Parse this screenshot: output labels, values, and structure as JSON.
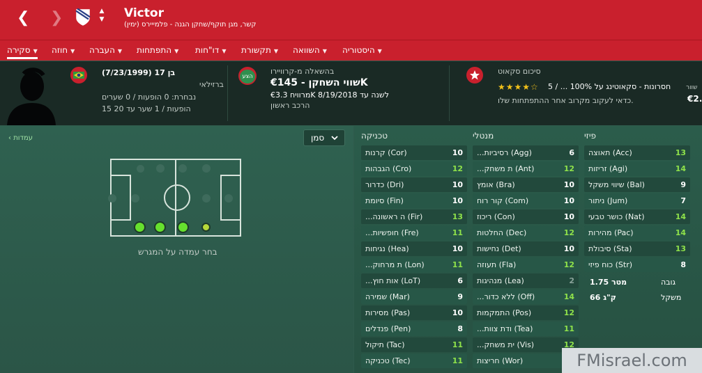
{
  "header": {
    "player_name": "Victor",
    "subtitle": "(ימין) קשר, מגן תוקף/שחקן הגנה - פלמייירס"
  },
  "tabs": [
    {
      "label": "סקירה",
      "active": true
    },
    {
      "label": "חוזה"
    },
    {
      "label": "העברה"
    },
    {
      "label": "התפתחות"
    },
    {
      "label": "דו\"חות"
    },
    {
      "label": "תקשורת"
    },
    {
      "label": "השוואה"
    },
    {
      "label": "היסטוריה"
    }
  ],
  "info": {
    "profile": {
      "age_text": "(7/23/1999) בן 17",
      "nationality": "ברזילאי",
      "caps": "נבחרת: 0 הופעות / 0 שערים",
      "club_stats": "15 הופעות / 1 שער עד 20"
    },
    "loan": {
      "badge": "הצע",
      "loan_text": "בהשאלה מ-קרוויירו",
      "value_label": "שווי השחקן - €145K",
      "wage_text": "מרוויח €3.3K לשנה עד 8/19/2018",
      "role": "הרכב ראשון"
    },
    "scout": {
      "heading": "סיכום סקאוט",
      "stars": 4,
      "summary": "5 / ... חסרונות - סקאוטינג על 100%",
      "note": "כדאי לעקוב מקרוב אחר ההתפתחות שלו.",
      "edge_label": "שוור",
      "edge_value": "€2."
    }
  },
  "left_panel": {
    "positions_link": "עמדות",
    "dropdown_value": "סמן",
    "pitch_hint": "בחר עמדה על המגרש"
  },
  "attributes": {
    "technical": {
      "heading": "טכניקה",
      "rows": [
        {
          "label": "קרנות (Cor)",
          "value": "10"
        },
        {
          "label": "הגבהות (Cro)",
          "value": "12"
        },
        {
          "label": "כדרור (Dri)",
          "value": "10"
        },
        {
          "label": "סיומת (Fin)",
          "value": "10"
        },
        {
          "label": "...ה ראשונה (Fir)",
          "value": "13"
        },
        {
          "label": "...חופשיות (Fre)",
          "value": "11"
        },
        {
          "label": "נגיחות (Hea)",
          "value": "10"
        },
        {
          "label": "...ת מרחוק (Lon)",
          "value": "11"
        },
        {
          "label": "...אות חוץ (LoT)",
          "value": "6"
        },
        {
          "label": "שמירה (Mar)",
          "value": "9"
        },
        {
          "label": "מסירות (Pas)",
          "value": "10"
        },
        {
          "label": "פנדלים (Pen)",
          "value": "8"
        },
        {
          "label": "תיקול (Tac)",
          "value": "11"
        },
        {
          "label": "טכניקה (Tec)",
          "value": "11"
        }
      ]
    },
    "mental": {
      "heading": "מנטלי",
      "rows": [
        {
          "label": "...רסיביות (Agg)",
          "value": "6"
        },
        {
          "label": "...ת משחק (Ant)",
          "value": "12"
        },
        {
          "label": "אומץ (Bra)",
          "value": "10"
        },
        {
          "label": "קור רוח (Com)",
          "value": "10"
        },
        {
          "label": "ריכוז (Con)",
          "value": "10"
        },
        {
          "label": "החלטות (Dec)",
          "value": "12"
        },
        {
          "label": "נחישות (Det)",
          "value": "10"
        },
        {
          "label": "תעוזה (Fla)",
          "value": "12"
        },
        {
          "label": "מנהיגות (Lea)",
          "value": "2"
        },
        {
          "label": "...ללא כדור (Off)",
          "value": "14"
        },
        {
          "label": "התמקמות (Pos)",
          "value": "12"
        },
        {
          "label": "...ודת צוות (Tea)",
          "value": "11"
        },
        {
          "label": "...ית משחק (Vis)",
          "value": "12"
        },
        {
          "label": "חריצות (Wor)",
          "value": "11"
        }
      ]
    },
    "physical": {
      "heading": "פיזי",
      "rows": [
        {
          "label": "תאוצה (Acc)",
          "value": "13"
        },
        {
          "label": "זריזות (Agi)",
          "value": "14"
        },
        {
          "label": "שיווי משקל (Bal)",
          "value": "9"
        },
        {
          "label": "ניתור (Jum)",
          "value": "7"
        },
        {
          "label": "כושר טבעי (Nat)",
          "value": "14"
        },
        {
          "label": "מהירות (Pac)",
          "value": "14"
        },
        {
          "label": "סיבולת (Sta)",
          "value": "13"
        },
        {
          "label": "כוח פיזי (Str)",
          "value": "8"
        }
      ],
      "height_label": "גובה",
      "height_value": "1.75 מטר",
      "weight_label": "משקל",
      "weight_value": "66 ק\"ג"
    }
  },
  "watermark": "FMisrael.com",
  "colors": {
    "header_red": "#c9202d",
    "attr_green": "#8fe24a",
    "panel_green": "#2b5c4b"
  }
}
